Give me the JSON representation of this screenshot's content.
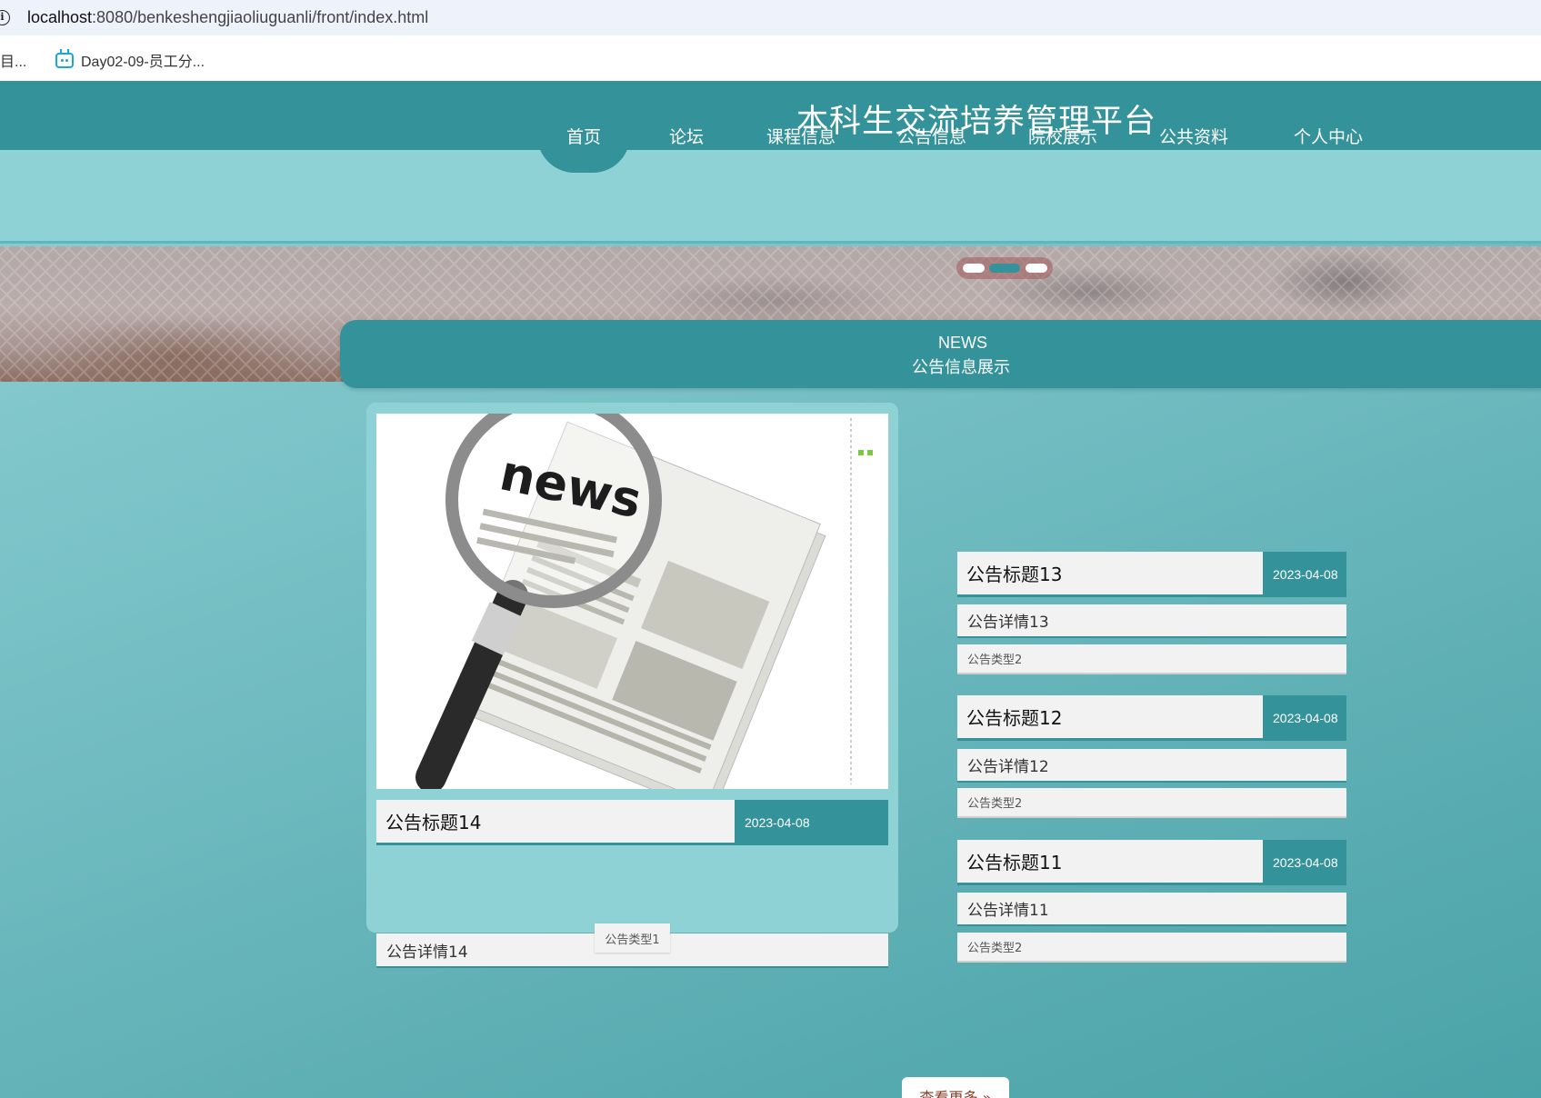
{
  "browser": {
    "url_host": "localhost",
    "url_rest": ":8080/benkeshengjiaoliuguanli/front/index.html",
    "bookmarks": [
      "目...",
      "Day02-09-员工分..."
    ]
  },
  "site": {
    "title": "本科生交流培养管理平台"
  },
  "nav": [
    {
      "label": "首页"
    },
    {
      "label": "论坛"
    },
    {
      "label": "课程信息"
    },
    {
      "label": "公告信息"
    },
    {
      "label": "院校展示"
    },
    {
      "label": "公共资料"
    },
    {
      "label": "个人中心"
    }
  ],
  "carousel": {
    "slide_count": 3,
    "active_index": 1
  },
  "section": {
    "title_en": "NEWS",
    "title_cn": "公告信息展示"
  },
  "featured": {
    "image_text": "news",
    "title": "公告标题14",
    "date": "2023-04-08",
    "detail": "公告详情14",
    "type": "公告类型1"
  },
  "list": [
    {
      "title": "公告标题13",
      "date": "2023-04-08",
      "detail": "公告详情13",
      "type": "公告类型2"
    },
    {
      "title": "公告标题12",
      "date": "2023-04-08",
      "detail": "公告详情12",
      "type": "公告类型2"
    },
    {
      "title": "公告标题11",
      "date": "2023-04-08",
      "detail": "公告详情11",
      "type": "公告类型2"
    }
  ],
  "more_label": "查看更多 »",
  "colors": {
    "primary": "#34939a",
    "nav_bg": "#8fd2d6",
    "card_bg": "#f2f2f2"
  }
}
